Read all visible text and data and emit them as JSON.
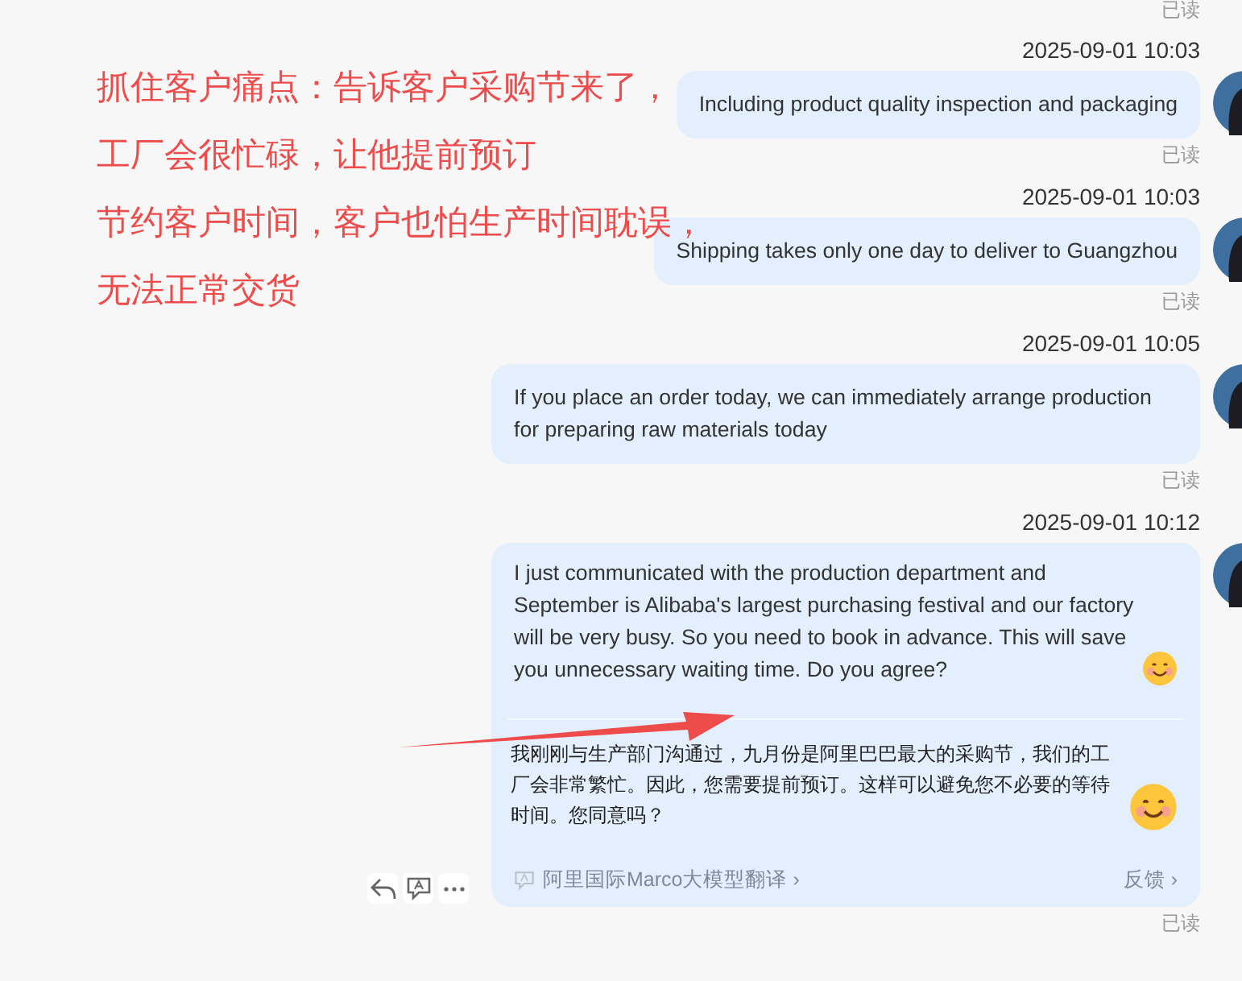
{
  "top_read_status": "已读",
  "messages": [
    {
      "time": "2025-09-01 10:03",
      "text": "Including product quality inspection and packaging",
      "trailing_emoji": false,
      "read_status": "已读"
    },
    {
      "time": "2025-09-01 10:03",
      "text": "Shipping takes only one day to deliver to Guangzhou",
      "trailing_emoji": false,
      "read_status": "已读"
    },
    {
      "time": "2025-09-01 10:05",
      "text": "If you place an order today, we can immediately arrange production for preparing raw materials today",
      "trailing_emoji": false,
      "read_status": "已读"
    },
    {
      "time": "2025-09-01 10:12",
      "text": "I just communicated with the production department and September is Alibaba's largest purchasing festival and our  factory will be very busy. So you need to book in advance. This will save you unnecessary waiting time. Do you agree?",
      "trailing_emoji": true,
      "read_status": "已读",
      "translation": {
        "text": "我刚刚与生产部门沟通过，九月份是阿里巴巴最大的采购节，我们的工厂会非常繁忙。因此，您需要提前预订。这样可以避免您不必要的等待时间。您同意吗？",
        "trailing_emoji": true,
        "source": "阿里国际Marco大模型翻译 ›",
        "feedback": "反馈 ›"
      },
      "actions": true
    }
  ],
  "annotation": {
    "lines": [
      "抓住客户痛点：告诉客户采购节来了，",
      "工厂会很忙碌，让他提前预订",
      "节约客户时间，客户也怕生产时间耽误，",
      "无法正常交货"
    ]
  }
}
